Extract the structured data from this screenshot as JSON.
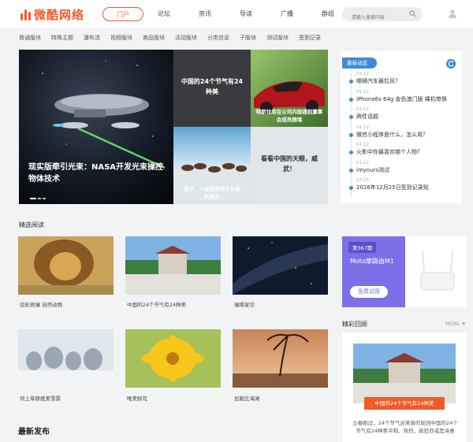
{
  "logo": {
    "text": "微酷网络"
  },
  "topnav": [
    "门户",
    "论坛",
    "资讯",
    "导读",
    "广播",
    "群组"
  ],
  "search": {
    "placeholder": "请输入搜索内容"
  },
  "subnav": [
    "普通版块",
    "特殊主题",
    "瀑布流",
    "视频版块",
    "商品版块",
    "活动版块",
    "分类信息",
    "子版块",
    "测试版块",
    "签到记录"
  ],
  "slider": {
    "caption": "现实版牵引光束：NASA开发光束操控物体技术"
  },
  "tiles": {
    "t1": "中国的24个节气有24种美",
    "t2": "特斯拉有在公司内部遇到董事会成员拥堵",
    "t3": "基子，一定要带孩子去做的地方",
    "t4": "看看中国的天眼，威武！"
  },
  "news": {
    "tab": "最新动态",
    "items": [
      {
        "date": "01-12",
        "text": "哪辆汽车最拉风？"
      },
      {
        "date": "01-12",
        "text": "iPhone6s 64g 金色澳门版 裸机带保"
      },
      {
        "date": "01-12",
        "text": "两性话题"
      },
      {
        "date": "01-12",
        "text": "微信小程序是什么，怎么用？"
      },
      {
        "date": "01-12",
        "text": "火影中你最喜欢哪个人物？"
      },
      {
        "date": "01-12",
        "text": "imyours测试"
      },
      {
        "date": "12-25",
        "text": "2016年12月25日签到记录贴"
      }
    ]
  },
  "featured": {
    "title": "精选阅读",
    "cards": [
      "炫彩斑斓 自然动物",
      "中国的24个节气有24种美",
      "璀璨星空",
      "坝上草原绝美雪景",
      "唯美鲜花",
      "加勒比海滩"
    ]
  },
  "ad": {
    "badge": "第367期",
    "title": "Moto摩路由M1",
    "button": "免费试用"
  },
  "review": {
    "title": "精彩回顾",
    "more": "MORE",
    "ribbon": "中国的24个节气有24种美",
    "desc": "立春刚过，24个节气迎来新的轮回中国的24个节气有24种美平和、热烈、疯狂亦或是诗意"
  },
  "latest": {
    "title": "最新发布"
  },
  "colors": {
    "accent": "#ef5b2a",
    "blue": "#3e8cd6",
    "ad_purple": "#7c6fe8"
  }
}
